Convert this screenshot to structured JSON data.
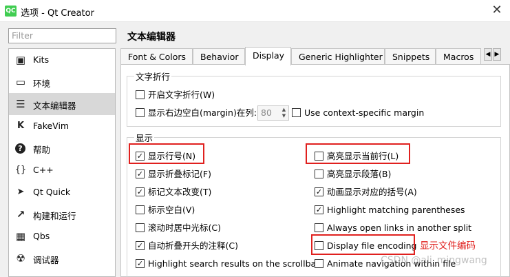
{
  "window": {
    "icon_text": "QC",
    "title": "选项 - Qt Creator",
    "close_glyph": "✕"
  },
  "filter": {
    "placeholder": "Filter"
  },
  "categories": [
    {
      "label": "Kits",
      "icon": "kits-icon",
      "glyph": "▣"
    },
    {
      "label": "环境",
      "icon": "monitor-icon",
      "glyph": "▭"
    },
    {
      "label": "文本编辑器",
      "icon": "text-editor-icon",
      "glyph": "☰",
      "selected": true
    },
    {
      "label": "FakeVim",
      "icon": "fakevim-icon",
      "glyph": "K"
    },
    {
      "label": "帮助",
      "icon": "help-icon",
      "glyph": "?"
    },
    {
      "label": "C++",
      "icon": "cpp-icon",
      "glyph": "{}"
    },
    {
      "label": "Qt Quick",
      "icon": "qt-quick-icon",
      "glyph": "➤"
    },
    {
      "label": "构建和运行",
      "icon": "build-run-icon",
      "glyph": "↗"
    },
    {
      "label": "Qbs",
      "icon": "qbs-icon",
      "glyph": "▦"
    },
    {
      "label": "调试器",
      "icon": "debugger-icon",
      "glyph": "☢"
    }
  ],
  "section_title": "文本编辑器",
  "tabs": [
    {
      "label": "Font & Colors"
    },
    {
      "label": "Behavior"
    },
    {
      "label": "Display",
      "active": true
    },
    {
      "label": "Generic Highlighter"
    },
    {
      "label": "Snippets"
    },
    {
      "label": "Macros"
    }
  ],
  "tab_arrows": {
    "left": "◀",
    "right": "▶"
  },
  "wrap_group": {
    "title": "文字折行",
    "enable_wrap": {
      "label": "开启文字折行(W)",
      "checked": false
    },
    "right_margin": {
      "label": "显示右边空白(margin)在列:",
      "checked": false,
      "value": "80"
    },
    "context_margin": {
      "label": "Use context-specific margin",
      "checked": false
    }
  },
  "display_group": {
    "title": "显示",
    "left_options": [
      {
        "label": "显示行号(N)",
        "checked": true
      },
      {
        "label": "显示折叠标记(F)",
        "checked": true
      },
      {
        "label": "标记文本改变(T)",
        "checked": true
      },
      {
        "label": "标示空白(V)",
        "checked": false
      },
      {
        "label": "滚动时居中光标(C)",
        "checked": false
      },
      {
        "label": "自动折叠开头的注释(C)",
        "checked": true
      },
      {
        "label": "Highlight search results on the scrollbar",
        "checked": true
      }
    ],
    "right_options": [
      {
        "label": "高亮显示当前行(L)",
        "checked": false
      },
      {
        "label": "高亮显示段落(B)",
        "checked": false
      },
      {
        "label": "动画显示对应的括号(A)",
        "checked": true
      },
      {
        "label": "Highlight matching parentheses",
        "checked": true
      },
      {
        "label": "Always open links in another split",
        "checked": false
      },
      {
        "label": "Display file encoding",
        "checked": false
      },
      {
        "label": "Animate navigation within file",
        "checked": false
      }
    ]
  },
  "annotation": {
    "text": "显示文件编码",
    "color": "#e0201e"
  },
  "watermark": "CSDN @ali_mingwang"
}
